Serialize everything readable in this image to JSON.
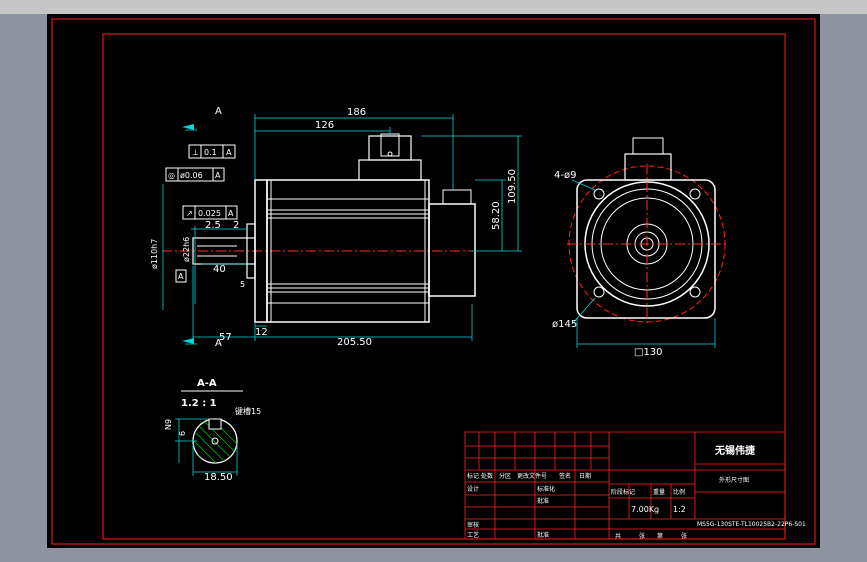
{
  "sheet": {
    "company": "无锡伟捷",
    "drawing_title": "外形尺寸图",
    "part_number": "MS5G-130STE-TL10025B2-22P6-S01",
    "weight": "7.00Kg",
    "scale": "1:2"
  },
  "title_block": {
    "rev_header": [
      "标记",
      "处数",
      "分区",
      "更改文件号",
      "签名",
      "日期"
    ],
    "row_design": [
      "设计",
      "",
      "",
      "标准化",
      "",
      ""
    ],
    "row_check": [
      "",
      "",
      "",
      "批准",
      "",
      ""
    ],
    "row_review": [
      "审核",
      "",
      "",
      "",
      "",
      ""
    ],
    "row_process": [
      "工艺",
      "",
      "",
      "批准",
      "",
      ""
    ],
    "stage_header": [
      "阶段标记",
      "重量",
      "比例"
    ],
    "sheet_info": [
      "共",
      "张",
      "第",
      "张"
    ]
  },
  "section_marks": {
    "top": "A",
    "bottom": "A"
  },
  "tolerances": [
    {
      "symbol": "⊥",
      "value": "0.1",
      "datum": "A"
    },
    {
      "symbol": "◎",
      "value": "ø0.06",
      "datum": "A"
    },
    {
      "symbol": "↗",
      "value": "0.025",
      "datum": "A"
    }
  ],
  "datum_label": "A",
  "side_dims": {
    "overall": "186",
    "body": "126",
    "height": "109.50",
    "centre_height": "58.20",
    "shaft_len": "40",
    "shoulder": "2.5",
    "shoulder_right": "2",
    "pilot": "ø110h7",
    "shaft_dia": "ø22h6",
    "flange_thk": "12",
    "bottom_left": "57",
    "length": "205.50",
    "small": "5"
  },
  "front_dims": {
    "holes": "4-ø9",
    "pcd": "ø145",
    "square": "□130"
  },
  "section": {
    "title": "A-A",
    "scale": "1.2 : 1",
    "width": "18.50",
    "height": "N9",
    "key": "6",
    "note": "键槽15"
  }
}
